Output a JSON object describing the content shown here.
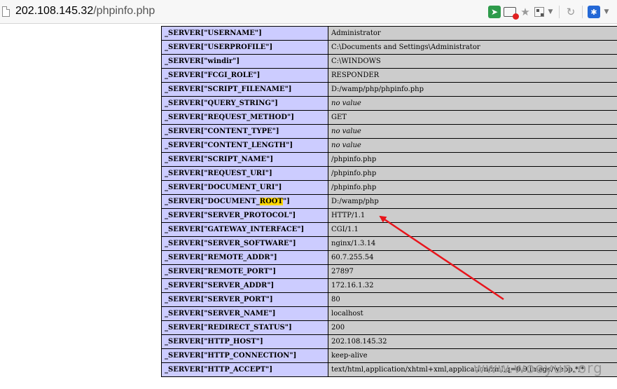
{
  "address": {
    "host": "202.108.145.32",
    "path": "/phpinfo.php"
  },
  "toolbar_icons": [
    "send-icon",
    "noscript-icon",
    "star-icon",
    "qr-code-icon",
    "chevron-down-icon",
    "reload-icon",
    "paw-icon",
    "chevron-down-icon"
  ],
  "rows": [
    {
      "key": "_SERVER[\"USERNAME\"]",
      "value": "Administrator"
    },
    {
      "key": "_SERVER[\"USERPROFILE\"]",
      "value": "C:\\Documents and Settings\\Administrator"
    },
    {
      "key": "_SERVER[\"windir\"]",
      "value": "C:\\WINDOWS"
    },
    {
      "key": "_SERVER[\"FCGI_ROLE\"]",
      "value": "RESPONDER"
    },
    {
      "key": "_SERVER[\"SCRIPT_FILENAME\"]",
      "value": "D:/wamp/php/phpinfo.php"
    },
    {
      "key": "_SERVER[\"QUERY_STRING\"]",
      "value": "no value",
      "italic": true
    },
    {
      "key": "_SERVER[\"REQUEST_METHOD\"]",
      "value": "GET"
    },
    {
      "key": "_SERVER[\"CONTENT_TYPE\"]",
      "value": "no value",
      "italic": true
    },
    {
      "key": "_SERVER[\"CONTENT_LENGTH\"]",
      "value": "no value",
      "italic": true
    },
    {
      "key": "_SERVER[\"SCRIPT_NAME\"]",
      "value": "/phpinfo.php"
    },
    {
      "key": "_SERVER[\"REQUEST_URI\"]",
      "value": "/phpinfo.php"
    },
    {
      "key": "_SERVER[\"DOCUMENT_URI\"]",
      "value": "/phpinfo.php"
    },
    {
      "key": "_SERVER[\"DOCUMENT_ROOT\"]",
      "key_prefix": "_SERVER[\"DOCUMENT_",
      "key_highlight": "ROOT",
      "key_suffix": "\"]",
      "value": "D:/wamp/php"
    },
    {
      "key": "_SERVER[\"SERVER_PROTOCOL\"]",
      "value": "HTTP/1.1"
    },
    {
      "key": "_SERVER[\"GATEWAY_INTERFACE\"]",
      "value": "CGI/1.1"
    },
    {
      "key": "_SERVER[\"SERVER_SOFTWARE\"]",
      "value": "nginx/1.3.14"
    },
    {
      "key": "_SERVER[\"REMOTE_ADDR\"]",
      "value": "60.7.255.54"
    },
    {
      "key": "_SERVER[\"REMOTE_PORT\"]",
      "value": "27897"
    },
    {
      "key": "_SERVER[\"SERVER_ADDR\"]",
      "value": "172.16.1.32"
    },
    {
      "key": "_SERVER[\"SERVER_PORT\"]",
      "value": "80"
    },
    {
      "key": "_SERVER[\"SERVER_NAME\"]",
      "value": "localhost"
    },
    {
      "key": "_SERVER[\"REDIRECT_STATUS\"]",
      "value": "200"
    },
    {
      "key": "_SERVER[\"HTTP_HOST\"]",
      "value": "202.108.145.32"
    },
    {
      "key": "_SERVER[\"HTTP_CONNECTION\"]",
      "value": "keep-alive"
    },
    {
      "key": "_SERVER[\"HTTP_ACCEPT\"]",
      "value": "text/html,application/xhtml+xml,application/xml;q=0.9,image/webp,*/*"
    }
  ],
  "watermark": "www.wooyun.org",
  "colors": {
    "key_cell": "#ccccff",
    "value_cell": "#cccccc",
    "highlight": "#ffd700",
    "arrow": "#e8141b"
  }
}
